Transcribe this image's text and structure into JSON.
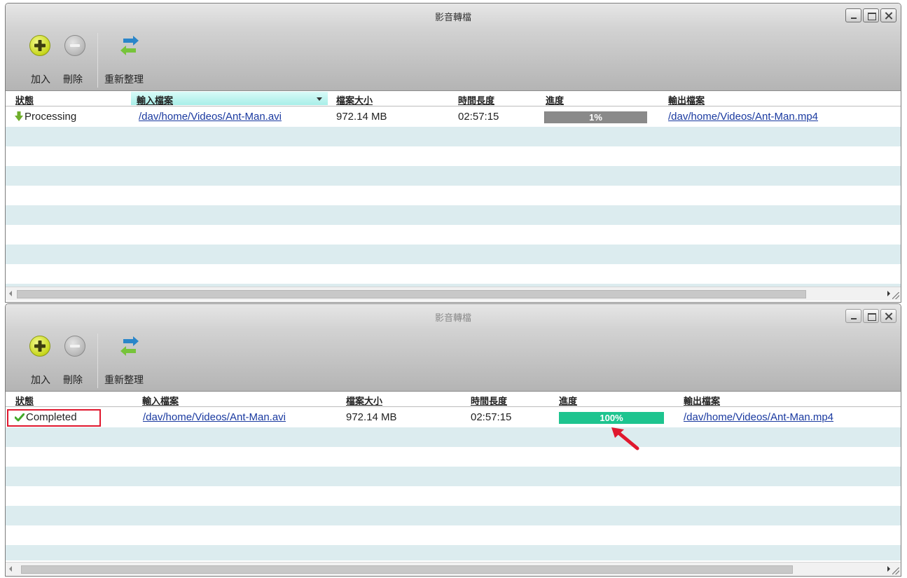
{
  "windows": [
    {
      "title": "影音轉檔",
      "toolbar": {
        "add_label": "加入",
        "remove_label": "刪除",
        "refresh_label": "重新整理"
      },
      "columns": {
        "status": "狀態",
        "input": "輸入檔案",
        "size": "檔案大小",
        "duration": "時間長度",
        "progress": "進度",
        "output": "輸出檔案"
      },
      "row": {
        "status": "Processing",
        "input": "/dav/home/Videos/Ant-Man.avi",
        "size": "972.14 MB",
        "duration": "02:57:15",
        "progress_text": "1%",
        "progress_fraction": 0.01,
        "output": "/dav/home/Videos/Ant-Man.mp4"
      }
    },
    {
      "title": "影音轉檔",
      "toolbar": {
        "add_label": "加入",
        "remove_label": "刪除",
        "refresh_label": "重新整理"
      },
      "columns": {
        "status": "狀態",
        "input": "輸入檔案",
        "size": "檔案大小",
        "duration": "時間長度",
        "progress": "進度",
        "output": "輸出檔案"
      },
      "row": {
        "status": "Completed",
        "input": "/dav/home/Videos/Ant-Man.avi",
        "size": "972.14 MB",
        "duration": "02:57:15",
        "progress_text": "100%",
        "progress_fraction": 1.0,
        "output": "/dav/home/Videos/Ant-Man.mp4"
      }
    }
  ],
  "colors": {
    "progress_processing": "#7a7a7a",
    "progress_completed": "#1ec48f",
    "annotation": "#e0182e",
    "link": "#1a3aa0"
  },
  "icons": {
    "processing": "down-arrow-icon",
    "completed": "checkmark-icon",
    "add": "plus-circle-icon",
    "remove": "minus-circle-icon",
    "refresh": "refresh-arrows-icon"
  }
}
